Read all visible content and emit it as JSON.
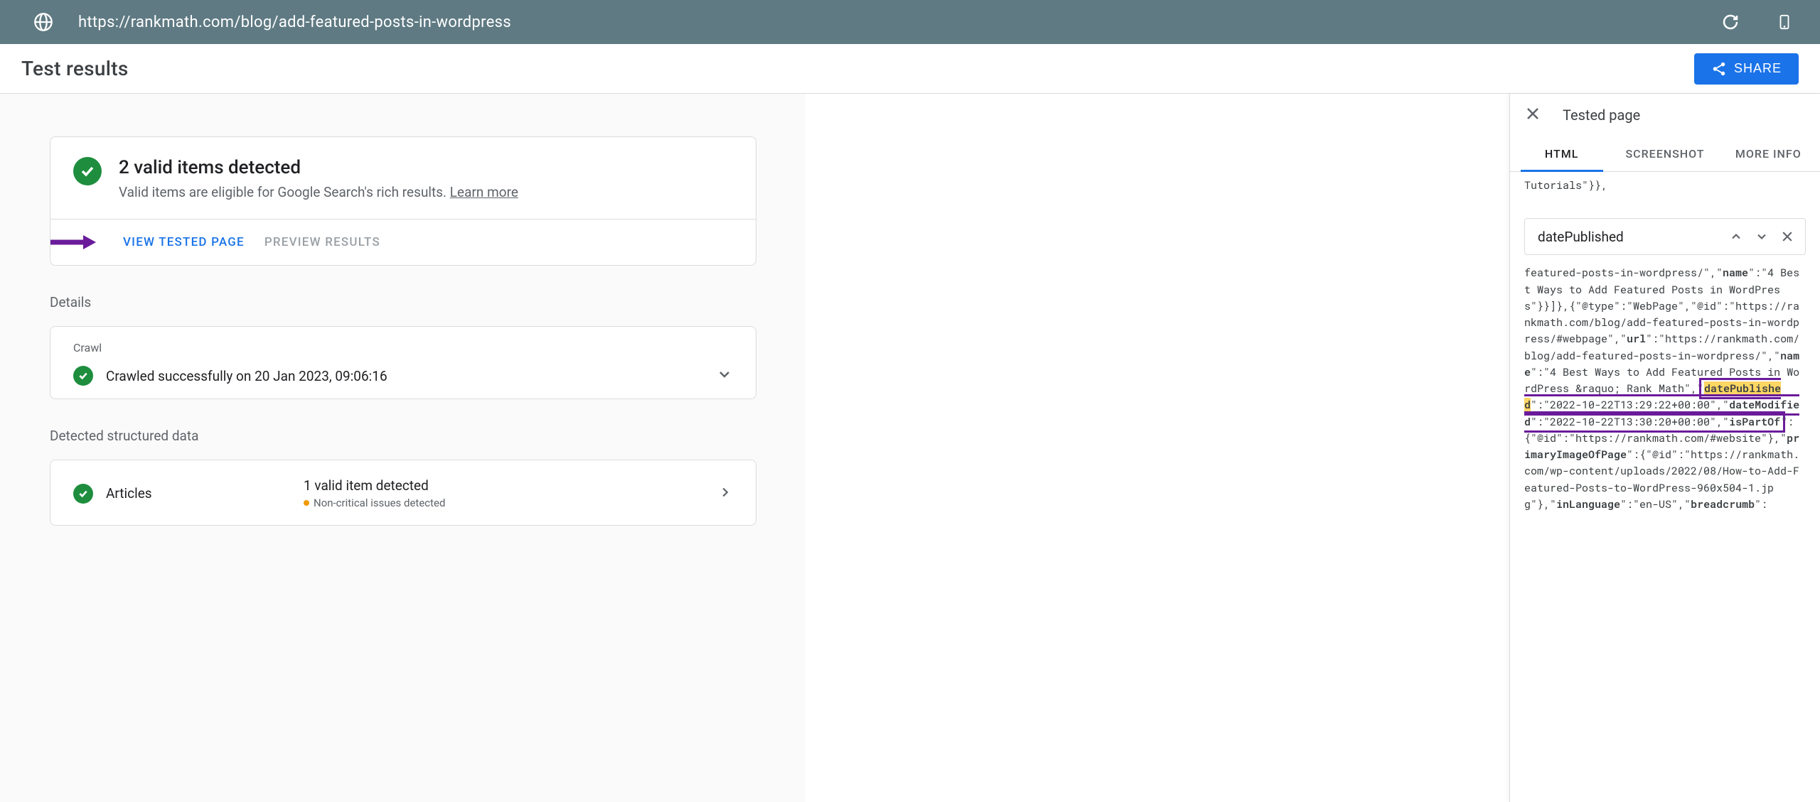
{
  "url": "https://rankmath.com/blog/add-featured-posts-in-wordpress",
  "header": {
    "title": "Test results",
    "share_label": "SHARE"
  },
  "summary": {
    "headline": "2 valid items detected",
    "subline": "Valid items are eligible for Google Search's rich results.",
    "learn_more": "Learn more",
    "view_tested": "VIEW TESTED PAGE",
    "preview_results": "PREVIEW RESULTS"
  },
  "details": {
    "label": "Details",
    "crawl_label": "Crawl",
    "crawl_status": "Crawled successfully on 20 Jan 2023, 09:06:16"
  },
  "structured": {
    "label": "Detected structured data",
    "item_name": "Articles",
    "item_count": "1 valid item detected",
    "issues": "Non-critical issues detected"
  },
  "panel": {
    "title": "Tested page",
    "tabs": {
      "html": "HTML",
      "screenshot": "SCREENSHOT",
      "more": "MORE INFO"
    },
    "search_value": "datePublished",
    "code": {
      "line1": "Tutorials\"}},",
      "line2_a": "featured-posts-in-wordpress/\",\"",
      "line2_b": "name",
      "line2_c": "\":\"4 Best Ways to Add Featured Posts in WordPress\"}}]},{\"@type\":\"WebPage\",\"@id\":\"https://rankmath.com/blog/add-featured-posts-in-wordpress/#webpage\",\"",
      "line2_d": "url",
      "line2_e": "\":\"https://rankmath.com/blog/add-featured-posts-in-wordpress/\",\"",
      "line2_f": "name",
      "line2_g": "\":\"4 Best Ways to Add Featured Posts in WordPress &raquo; Rank Math\",\"",
      "hl": "datePublished",
      "date1": "\":\"2022-10-22T13:29:22+00:00\",\"",
      "dm": "dateModified",
      "date2": "\":\"2022-10-22T13:30:20+00:00\",\"",
      "ipo": "isPartOf",
      "tail1": "\":{\"@id\":\"https://rankmath.com/#website\"},\"",
      "pimg": "primaryImageOfPage",
      "tail2": "\":{\"@id\":\"https://rankmath.com/wp-content/uploads/2022/08/How-to-Add-Featured-Posts-to-WordPress-960x504-1.jpg\"},\"",
      "inlang": "inLanguage",
      "tail3": "\":\"en-US\",\"",
      "bc": "breadcrumb",
      "tail4": "\":"
    }
  }
}
